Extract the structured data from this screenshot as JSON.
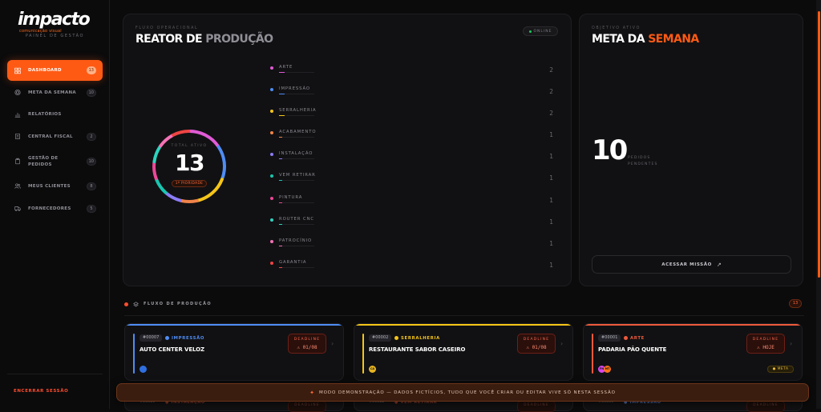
{
  "brand": {
    "name": "impacto",
    "tagline": "comunicação visual",
    "caption": "PAINEL DE GESTÃO"
  },
  "sidebar": {
    "items": [
      {
        "label": "DASHBOARD",
        "badge": "13",
        "icon": "grid-icon",
        "active": true
      },
      {
        "label": "META DA SEMANA",
        "badge": "10",
        "icon": "target-icon"
      },
      {
        "label": "RELATÓRIOS",
        "badge": "",
        "icon": "bar-chart-icon"
      },
      {
        "label": "CENTRAL FISCAL",
        "badge": "2",
        "icon": "receipt-icon"
      },
      {
        "label": "GESTÃO DE PEDIDOS",
        "badge": "10",
        "icon": "clipboard-icon"
      },
      {
        "label": "MEUS CLIENTES",
        "badge": "8",
        "icon": "users-icon"
      },
      {
        "label": "FORNECEDORES",
        "badge": "5",
        "icon": "truck-icon"
      }
    ],
    "logout": "ENCERRAR SESSÃO"
  },
  "reactor": {
    "kicker": "FLUXO OPERACIONAL",
    "title_main": "REATOR DE ",
    "title_highlight": "PRODUÇÃO",
    "status": "ONLINE",
    "total_kicker": "TOTAL ATIVO",
    "total_value": "13",
    "pill": "1º PIORIDADE",
    "stages": [
      {
        "name": "ARTE",
        "count": "2",
        "color": "#e05bd6",
        "share": 0.15
      },
      {
        "name": "IMPRESSÃO",
        "count": "2",
        "color": "#4f8df5",
        "share": 0.15
      },
      {
        "name": "SERRALHERIA",
        "count": "2",
        "color": "#f5c518",
        "share": 0.15
      },
      {
        "name": "ACABAMENTO",
        "count": "1",
        "color": "#f0834a",
        "share": 0.08
      },
      {
        "name": "INSTALAÇÃO",
        "count": "1",
        "color": "#8b7cf6",
        "share": 0.08
      },
      {
        "name": "VEM RETIRAR",
        "count": "1",
        "color": "#19c6b0",
        "share": 0.08
      },
      {
        "name": "PINTURA",
        "count": "1",
        "color": "#ec4899",
        "share": 0.08
      },
      {
        "name": "ROUTER CNC",
        "count": "1",
        "color": "#2dd4bf",
        "share": 0.08
      },
      {
        "name": "PATROCÍNIO",
        "count": "1",
        "color": "#f472b6",
        "share": 0.08
      },
      {
        "name": "GARANTIA",
        "count": "1",
        "color": "#ef4444",
        "share": 0.08
      }
    ]
  },
  "goal": {
    "kicker": "OBJETIVO ATIVO",
    "title_main": "META DA ",
    "title_highlight": "SEMANA",
    "value": "10",
    "sub_line1": "PEDIDOS",
    "sub_line2": "PENDENTES",
    "button": "ACESSAR MISSÃO"
  },
  "flow": {
    "title": "FLUXO DE PRODUÇÃO",
    "count": "13",
    "orders": [
      {
        "id": "#00007",
        "stage": "IMPRESSÃO",
        "stage_color": "#4f8df5",
        "client": "AUTO CENTER VELOZ",
        "deadline_label": "DEADLINE",
        "deadline": "⚠ 01/08",
        "avatars": [
          {
            "text": "",
            "color": "#2f6fe0"
          }
        ],
        "tag": ""
      },
      {
        "id": "#00002",
        "stage": "SERRALHERIA",
        "stage_color": "#f5c518",
        "client": "RESTAURANTE SABOR CASEIRO",
        "deadline_label": "DEADLINE",
        "deadline": "⚠ 01/08",
        "avatars": [
          {
            "text": "CA",
            "color": "#e6b422"
          }
        ],
        "tag": ""
      },
      {
        "id": "#00001",
        "stage": "ARTE",
        "stage_color": "#ef5a3c",
        "client": "PADARIA PÃO QUENTE",
        "deadline_label": "DEADLINE",
        "deadline": "⚠ HOJE",
        "avatars": [
          {
            "text": "FN",
            "color": "#d946ef"
          },
          {
            "text": "MT",
            "color": "#f97316"
          }
        ],
        "tag": "● META"
      }
    ],
    "next_row": [
      {
        "id": "#00010",
        "stage": "● INSTALAÇÃO",
        "stage_color": "#8b3a2a",
        "deadline_label": "DEADLINE"
      },
      {
        "id": "#00012",
        "stage": "● VEM RETIRAR",
        "stage_color": "#8b3a2a",
        "deadline_label": "DEADLINE"
      },
      {
        "id": "#00005",
        "stage": "● IMPRESSÃO",
        "stage_color": "#4f6fb0",
        "deadline_label": "DEADLINE"
      }
    ]
  },
  "toast": {
    "text": "MODO DEMONSTRAÇÃO — DADOS FICTÍCIOS, TUDO QUE VOCÊ CRIAR OU EDITAR VIVE SÓ NESTA SESSÃO"
  },
  "colors": {
    "accent": "#ff5a14",
    "danger": "#ff4d2e",
    "online": "#22c55e"
  }
}
